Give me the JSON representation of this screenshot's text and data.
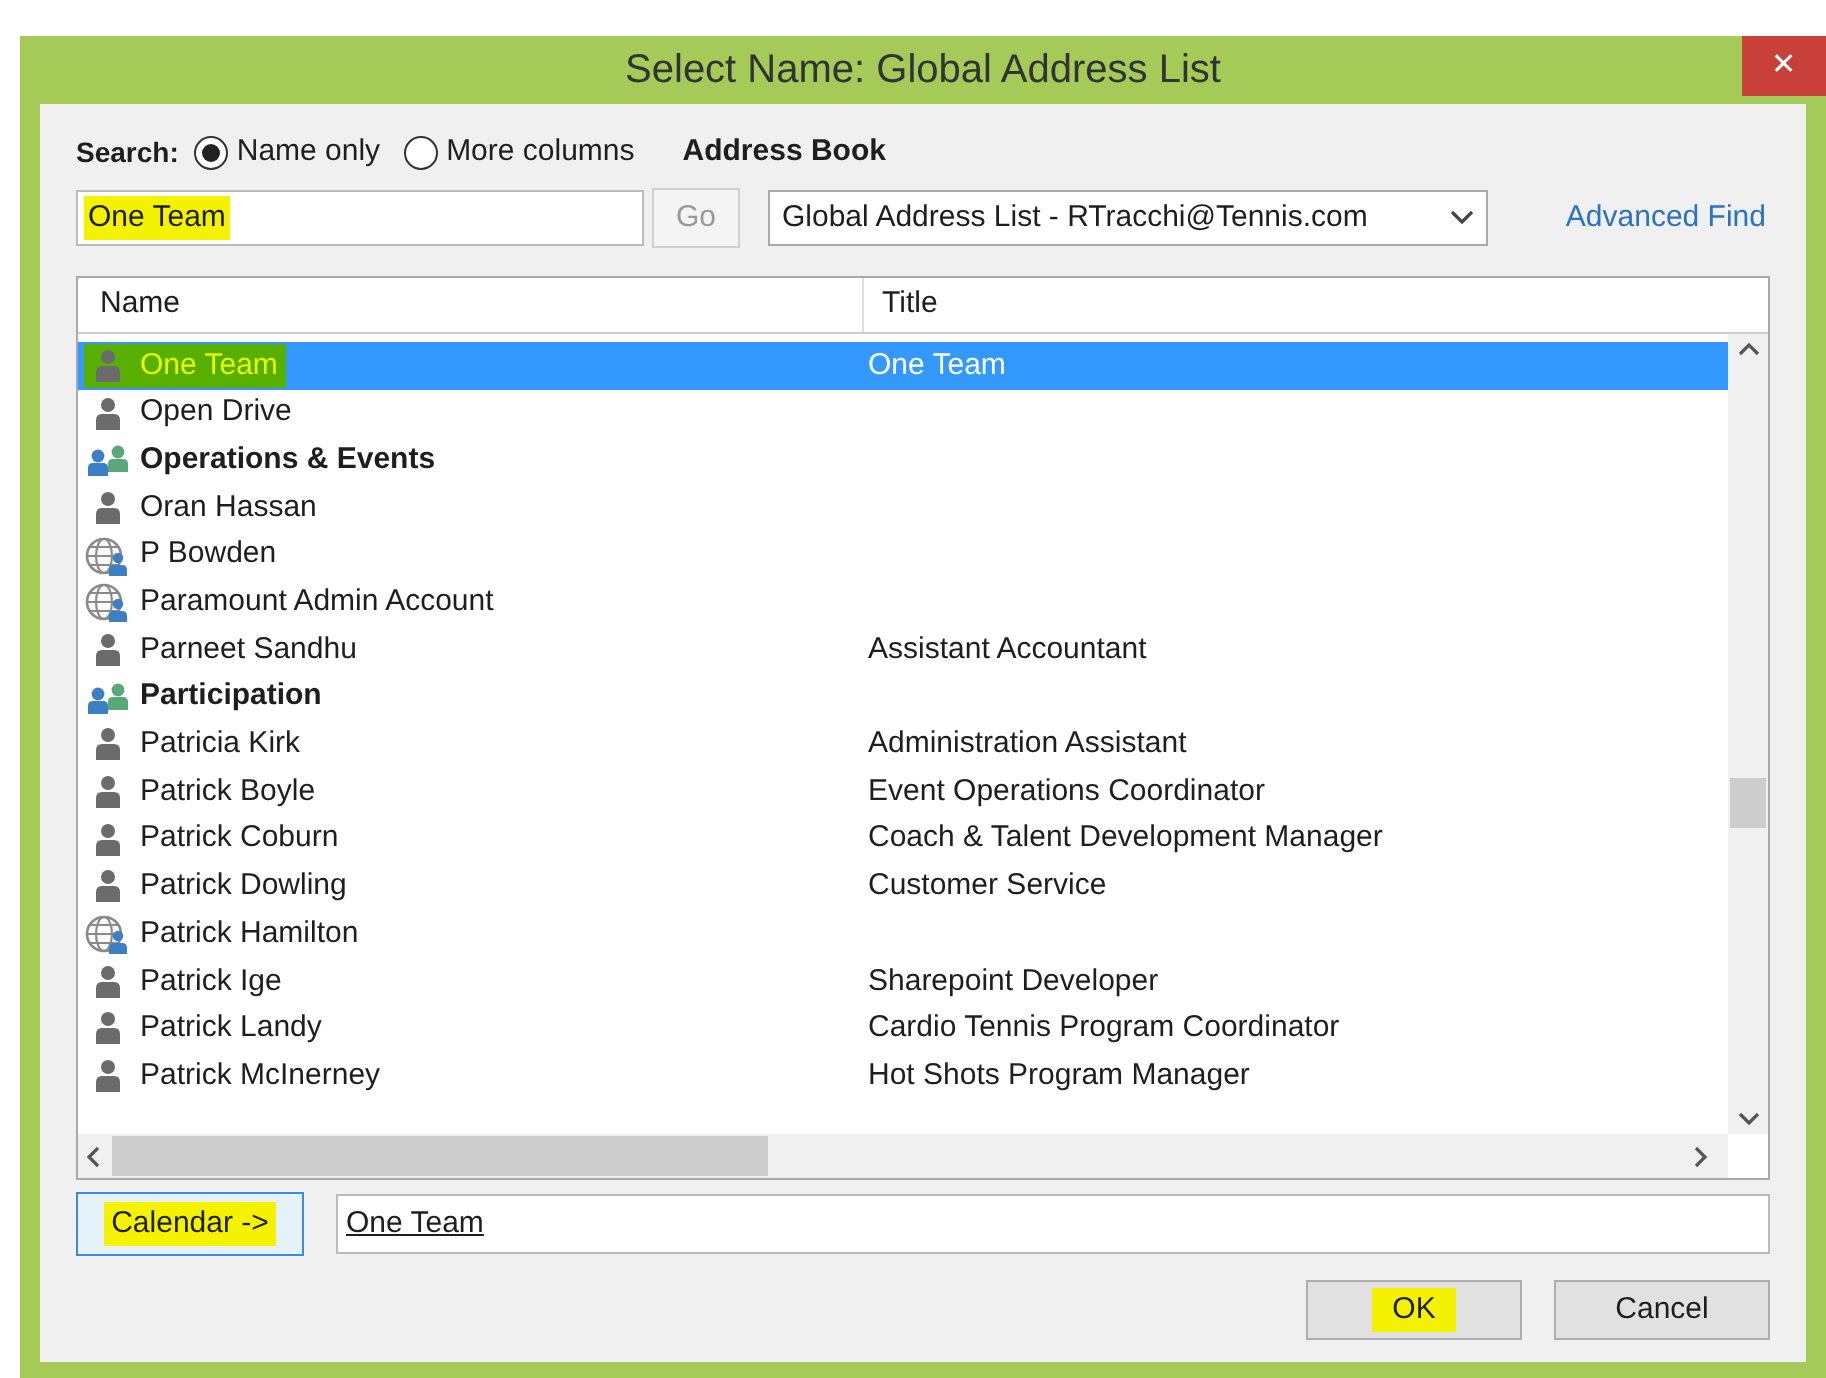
{
  "window": {
    "title": "Select Name: Global Address List",
    "close": "✕"
  },
  "search": {
    "label": "Search:",
    "options": [
      {
        "label": "Name only",
        "selected": true
      },
      {
        "label": "More columns",
        "selected": false
      }
    ],
    "value": "One Team",
    "value_highlighted": true,
    "go": "Go"
  },
  "address_book": {
    "label": "Address Book",
    "value": "Global Address List - RTracchi@Tennis.com",
    "advanced_find": "Advanced Find"
  },
  "table": {
    "columns": [
      "Name",
      "Title"
    ],
    "rows": [
      {
        "kind": "user",
        "name": "One Team",
        "title": "One Team",
        "selected": true,
        "highlighted": true
      },
      {
        "kind": "user",
        "name": "Open Drive",
        "title": "",
        "selected": false,
        "highlighted": false
      },
      {
        "kind": "group",
        "name": "Operations & Events",
        "title": "",
        "selected": false,
        "highlighted": false
      },
      {
        "kind": "user",
        "name": "Oran Hassan",
        "title": "",
        "selected": false,
        "highlighted": false
      },
      {
        "kind": "external",
        "name": "P Bowden",
        "title": "",
        "selected": false,
        "highlighted": false
      },
      {
        "kind": "external",
        "name": "Paramount Admin Account",
        "title": "",
        "selected": false,
        "highlighted": false
      },
      {
        "kind": "user",
        "name": "Parneet Sandhu",
        "title": "Assistant Accountant",
        "selected": false,
        "highlighted": false
      },
      {
        "kind": "group",
        "name": "Participation",
        "title": "",
        "selected": false,
        "highlighted": false
      },
      {
        "kind": "user",
        "name": "Patricia Kirk",
        "title": "Administration Assistant",
        "selected": false,
        "highlighted": false
      },
      {
        "kind": "user",
        "name": "Patrick Boyle",
        "title": "Event Operations Coordinator",
        "selected": false,
        "highlighted": false
      },
      {
        "kind": "user",
        "name": "Patrick Coburn",
        "title": "Coach & Talent Development Manager",
        "selected": false,
        "highlighted": false
      },
      {
        "kind": "user",
        "name": "Patrick Dowling",
        "title": "Customer Service",
        "selected": false,
        "highlighted": false
      },
      {
        "kind": "external",
        "name": "Patrick Hamilton",
        "title": "",
        "selected": false,
        "highlighted": false
      },
      {
        "kind": "user",
        "name": "Patrick Ige",
        "title": "Sharepoint Developer",
        "selected": false,
        "highlighted": false
      },
      {
        "kind": "user",
        "name": "Patrick Landy",
        "title": "Cardio Tennis Program Coordinator",
        "selected": false,
        "highlighted": false
      },
      {
        "kind": "user",
        "name": "Patrick McInerney",
        "title": "Hot Shots Program Manager",
        "selected": false,
        "highlighted": false
      }
    ]
  },
  "recipient": {
    "button": "Calendar ->",
    "button_highlighted": true,
    "value": "One Team"
  },
  "buttons": [
    {
      "label": "OK",
      "highlighted": true
    },
    {
      "label": "Cancel",
      "highlighted": false
    }
  ]
}
